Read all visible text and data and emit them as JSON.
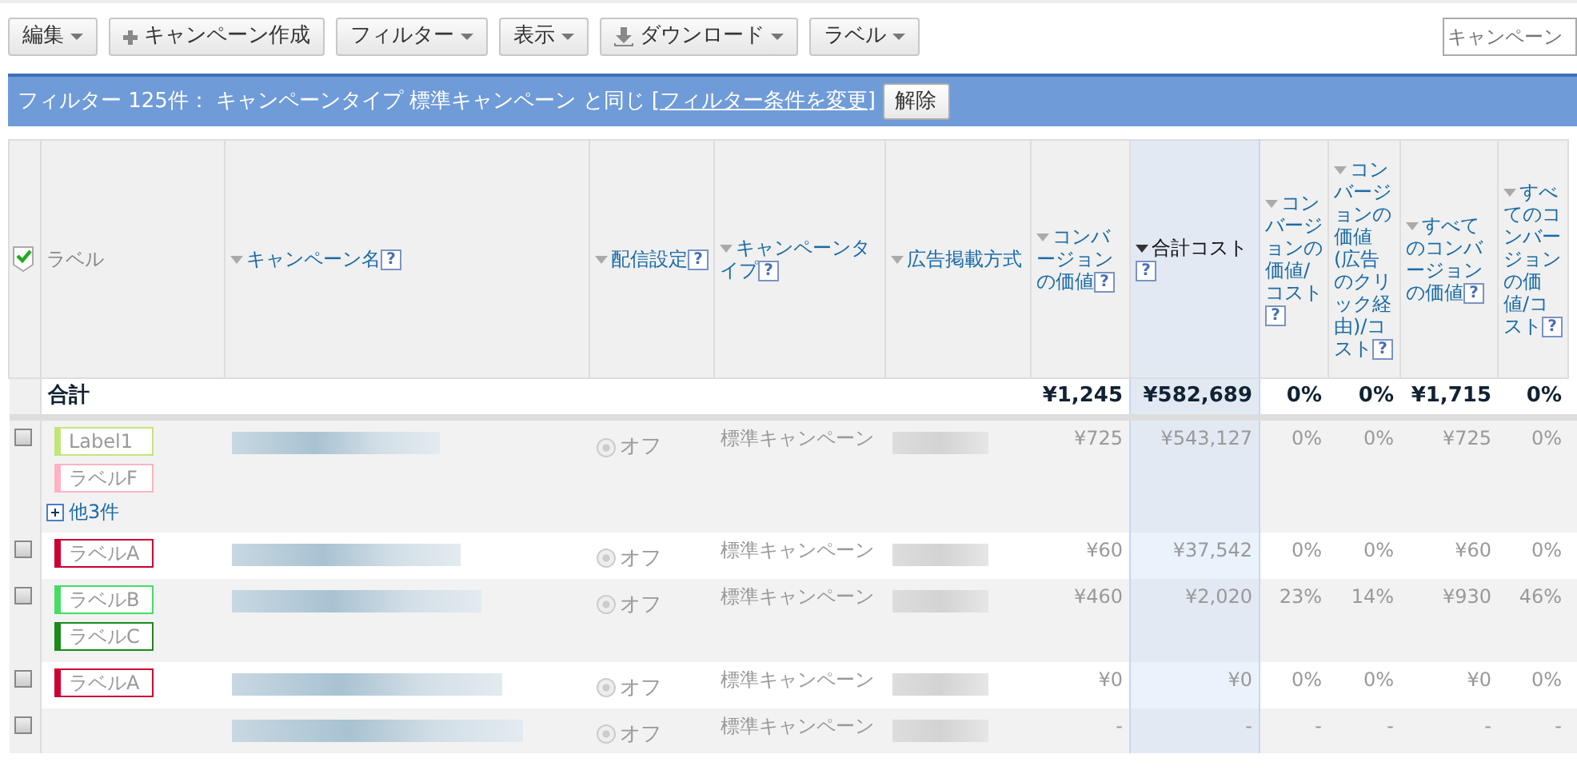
{
  "toolbar": {
    "buttons": [
      {
        "label": "編集",
        "kind": "dropdown"
      },
      {
        "label": "キャンペーン作成",
        "kind": "plus"
      },
      {
        "label": "フィルター",
        "kind": "dropdown"
      },
      {
        "label": "表示",
        "kind": "dropdown"
      },
      {
        "label": "ダウンロード",
        "kind": "download"
      },
      {
        "label": "ラベル",
        "kind": "dropdown"
      }
    ],
    "search": {
      "placeholder": "キャンペーン"
    }
  },
  "filter_bar": {
    "text": "フィルター 125件： キャンペーンタイプ 標準キャンペーン と同じ",
    "link": "[フィルター条件を変更]",
    "button": "解除"
  },
  "table": {
    "select_all": {
      "checked": true
    },
    "columns": [
      {
        "label": "ラベル",
        "sortable": false,
        "sorted": false
      },
      {
        "label": "キャンペーン名",
        "sortable": true,
        "help": "?",
        "sorted": false
      },
      {
        "label": "配信設定",
        "sortable": true,
        "help": "?",
        "sorted": false
      },
      {
        "label": "キャンペーンタイプ",
        "sortable": true,
        "help": "?",
        "sorted": false
      },
      {
        "label": "広告掲載方式",
        "sortable": true,
        "sorted": false
      },
      {
        "label": "コンバージョンの価値",
        "sortable": true,
        "help": "?",
        "sorted": false
      },
      {
        "label": "合計コスト",
        "sortable": true,
        "help": "?",
        "sorted": true
      },
      {
        "label": "コンバージョンの価値/コスト",
        "sortable": true,
        "help": "?",
        "sorted": false
      },
      {
        "label": "コンバージョンの価値(広告のクリック経由)/コスト",
        "sortable": true,
        "help": "?",
        "sorted": false
      },
      {
        "label": "すべてのコンバージョンの価値",
        "sortable": true,
        "help": "?",
        "sorted": false
      },
      {
        "label": "すべてのコンバージョンの価値/コスト",
        "sortable": true,
        "help": "?",
        "sorted": false
      }
    ],
    "total": {
      "label": "合計",
      "values": [
        "¥1,245",
        "¥582,689",
        "0%",
        "0%",
        "¥1,715",
        "0%"
      ]
    },
    "rows": [
      {
        "checked": false,
        "labels": [
          {
            "text": "Label1",
            "color": "#c2e57a"
          },
          {
            "text": "ラベルF",
            "color": "#ffb3c1"
          }
        ],
        "more": "他3件",
        "status": "オフ",
        "type": "標準キャンペーン",
        "values": [
          "¥725",
          "¥543,127",
          "0%",
          "0%",
          "¥725",
          "0%"
        ]
      },
      {
        "checked": false,
        "labels": [
          {
            "text": "ラベルA",
            "color": "#cc0033"
          }
        ],
        "status": "オフ",
        "type": "標準キャンペーン",
        "values": [
          "¥60",
          "¥37,542",
          "0%",
          "0%",
          "¥60",
          "0%"
        ]
      },
      {
        "checked": false,
        "labels": [
          {
            "text": "ラベルB",
            "color": "#44dd66"
          },
          {
            "text": "ラベルC",
            "color": "#1a8a1a"
          }
        ],
        "status": "オフ",
        "type": "標準キャンペーン",
        "values": [
          "¥460",
          "¥2,020",
          "23%",
          "14%",
          "¥930",
          "46%"
        ]
      },
      {
        "checked": false,
        "labels": [
          {
            "text": "ラベルA",
            "color": "#cc0033"
          }
        ],
        "status": "オフ",
        "type": "標準キャンペーン",
        "values": [
          "¥0",
          "¥0",
          "0%",
          "0%",
          "¥0",
          "0%"
        ]
      },
      {
        "checked": false,
        "labels": [],
        "status": "オフ",
        "type": "標準キャンペーン",
        "values": [
          "-",
          "-",
          "-",
          "-",
          "-",
          "-"
        ]
      }
    ]
  }
}
